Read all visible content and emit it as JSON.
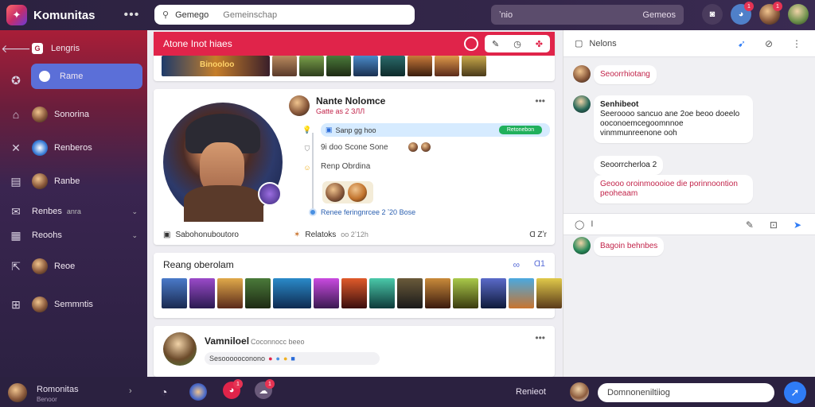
{
  "header": {
    "app_title": "Komunitas",
    "more": "•••",
    "search_query": "Gemego",
    "search_placeholder": "Gemeinschap",
    "pill_left": "ʼnio",
    "pill_right": "Gemeos",
    "badges": [
      "1",
      "1"
    ]
  },
  "sidebar": {
    "items": [
      {
        "label": "Lengris"
      },
      {
        "label": "Rame"
      },
      {
        "label": "Sonorina"
      },
      {
        "label": "Renberos"
      },
      {
        "label": "Ranbe"
      },
      {
        "label": "Renbes",
        "extra": "anra"
      },
      {
        "label": "Reoohs"
      },
      {
        "label": "Reoe"
      },
      {
        "label": "Semmntis"
      }
    ]
  },
  "feed": {
    "hero_title": "Atone Inot hiaes",
    "hero_banner": "Binooloo",
    "profile": {
      "name": "Nante Nolomce",
      "handle": "Gatte as 2 ЗЛЛ",
      "pill_text": "Sanp gg hoo",
      "pill_btn": "Retonebon",
      "line2": "9i doo Scone Sone",
      "line3": "Renp Obrdina",
      "line4": "Renee feringnrcee 2 ʼ20 Bose",
      "footer_left": "Sabohonuboutoro",
      "footer_mid": "Relatoks",
      "footer_mid2": "oo 2ʼ12h",
      "footer_right": "Ɑ Zʼr",
      "more": "•••"
    },
    "gallery": {
      "title": "Reang oberolam",
      "count": "Ɑ1"
    },
    "post": {
      "name": "Vamniloel",
      "sub": "Coconnocc beeo",
      "meta": "Sesoooooconono",
      "more": "•••"
    }
  },
  "chat": {
    "title": "Nelons",
    "messages": [
      {
        "text": "Seoorrhiotang"
      },
      {
        "name": "Senhibeot",
        "text": "Seeroooo sancuo ane 2oe beoo doeelo ooconoemcegoomnnoe vinmmunreenone ooh"
      },
      {
        "text": "Seoorrcherloa 2"
      },
      {
        "text": "Geooo oroinmoooioe die porinnoontion",
        "sub": "peoheaam"
      }
    ],
    "compose_label": "I",
    "last_message": "Bagoin behnbes"
  },
  "bottombar": {
    "user_name": "Romonitas",
    "user_sub": "Benoor",
    "right_label": "Renieot",
    "input_placeholder": "Domnoneniltiiog",
    "badges": [
      "1",
      "1"
    ]
  },
  "colors": {
    "accent": "#e0244a",
    "active_nav": "#5b6fd8",
    "send": "#2f7cf6",
    "green": "#20b05c"
  }
}
